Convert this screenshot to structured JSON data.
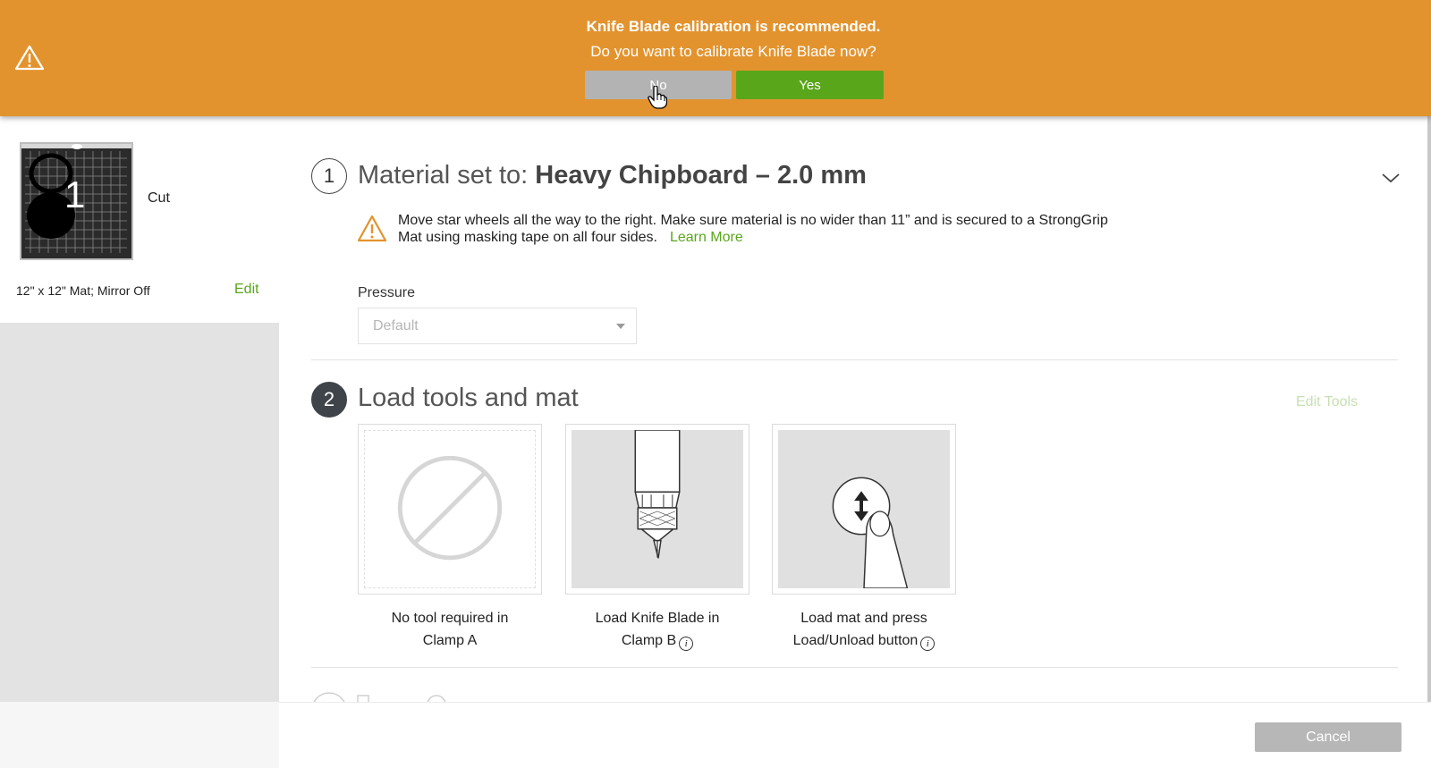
{
  "banner": {
    "title": "Knife Blade calibration is recommended.",
    "question": "Do you want to calibrate Knife Blade now?",
    "no_label": "No",
    "yes_label": "Yes",
    "background": "#e3932e",
    "icon": "warning-icon"
  },
  "mat": {
    "number": "1",
    "label": "Cut",
    "info": "12\" x 12\" Mat; Mirror Off",
    "edit_label": "Edit"
  },
  "step1": {
    "number": "1",
    "title_prefix": "Material set to: ",
    "material": "Heavy Chipboard – 2.0 mm",
    "instruction": "Move star wheels all the way to the right. Make sure material is no wider than 11” and is secured to a StrongGrip Mat using masking tape on all four sides.",
    "learn_more": "Learn More",
    "pressure_label": "Pressure",
    "pressure_value": "Default"
  },
  "step2": {
    "number": "2",
    "title": "Load tools and mat",
    "edit_tools": "Edit Tools",
    "cards": [
      {
        "line1": "No tool required in",
        "line2": "Clamp A",
        "icon": "no-tool-icon"
      },
      {
        "line1": "Load Knife Blade in",
        "line2": "Clamp B",
        "icon": "knife-blade-icon"
      },
      {
        "line1": "Load mat and press",
        "line2": "Load/Unload button",
        "icon": "load-unload-icon"
      }
    ],
    "info_glyph": "i"
  },
  "footer": {
    "cancel_label": "Cancel"
  },
  "colors": {
    "accent_green": "#5aa61b",
    "banner_orange": "#e3932e",
    "step_dark": "#3f444a"
  }
}
